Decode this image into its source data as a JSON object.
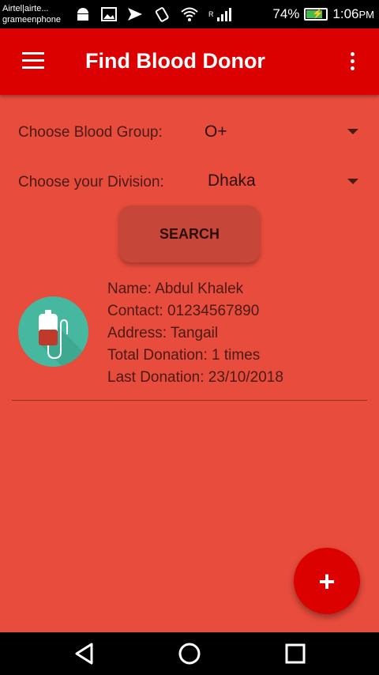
{
  "status_bar": {
    "carrier_line1": "Airtel|airte...",
    "carrier_line2": "grameenphone",
    "network_tag": "R",
    "battery": "74%",
    "battery_level": 0.74,
    "time": "1:06",
    "ampm": "PM",
    "icons": [
      "android-icon",
      "image-icon",
      "send-icon",
      "vibrate-icon",
      "wifi-icon",
      "signal-icon",
      "battery-charging-icon"
    ]
  },
  "app_bar": {
    "title": "Find Blood Donor",
    "menu_icon": "hamburger-icon",
    "overflow_icon": "more-vert-icon",
    "color": "#dc0101"
  },
  "filters": {
    "blood_group_label": "Choose Blood Group:",
    "blood_group_value": "O+",
    "division_label": "Choose your Division:",
    "division_value": "Dhaka"
  },
  "search_button": {
    "label": "SEARCH"
  },
  "donor": {
    "name": "Name: Abdul Khalek",
    "contact": "Contact: 01234567890",
    "address": "Address: Tangail",
    "total_donation": "Total Donation: 1 times",
    "last_donation": "Last Donation: 23/10/2018",
    "avatar_icon": "blood-bag-icon"
  },
  "fab": {
    "label": "+"
  },
  "nav_bar": {
    "icons": [
      "back-icon",
      "home-icon",
      "recents-icon"
    ]
  },
  "colors": {
    "background": "#e84c3d",
    "app_bar": "#dc0101",
    "avatar": "#46b8a0"
  }
}
